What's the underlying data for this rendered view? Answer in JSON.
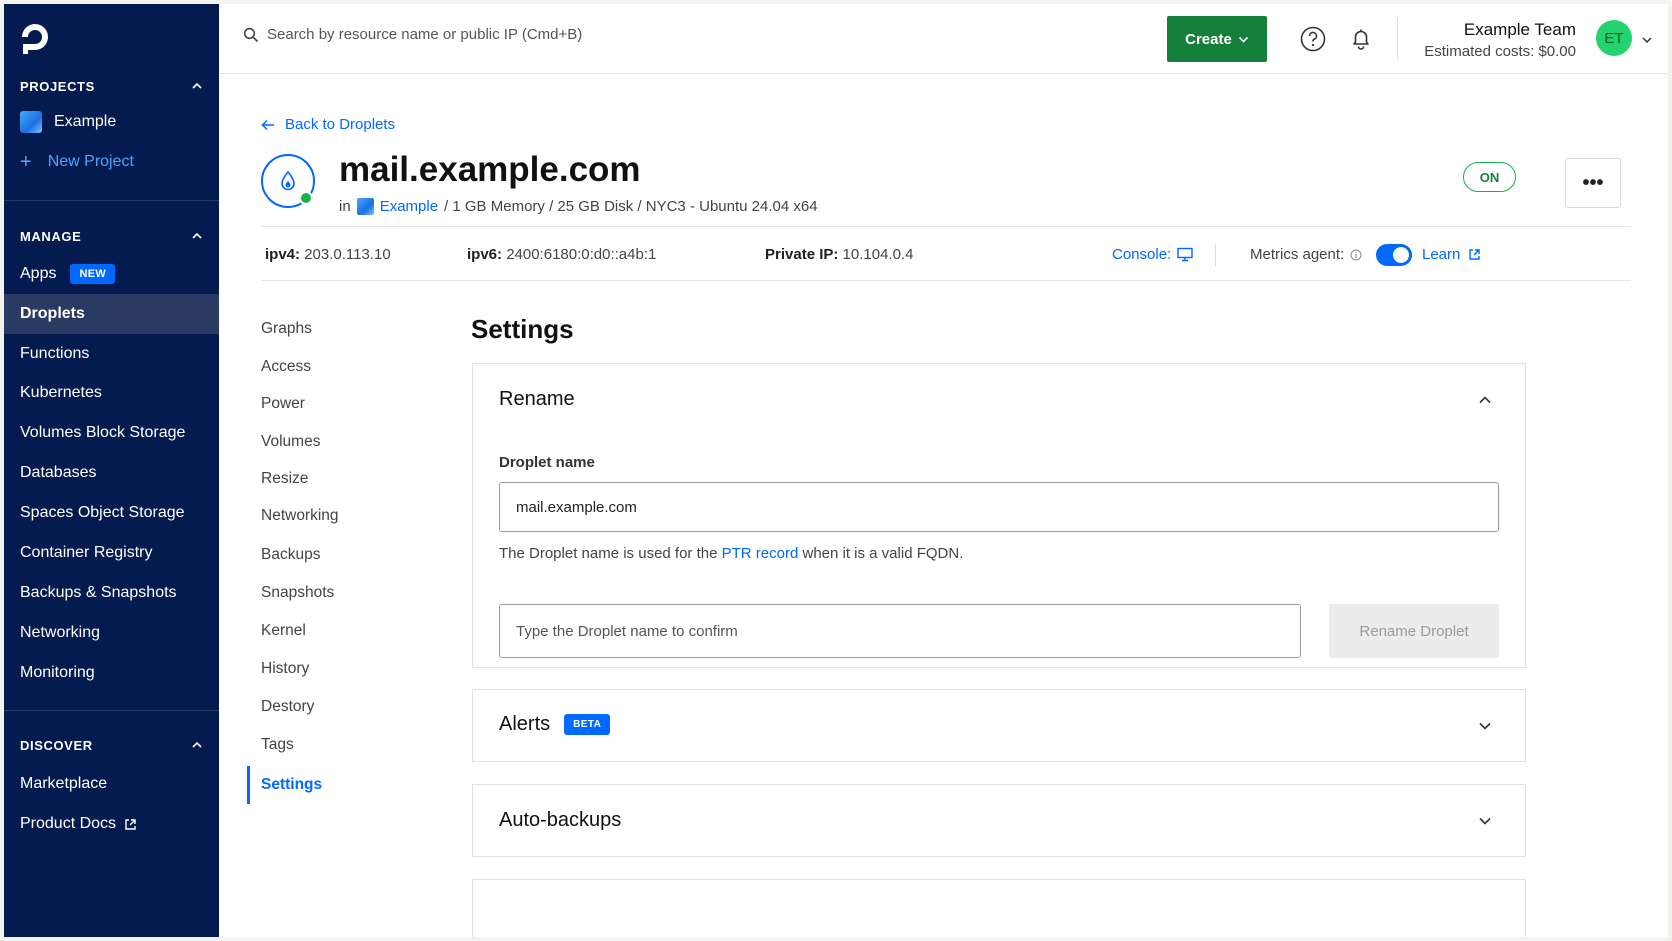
{
  "sidebar": {
    "projects_heading": "PROJECTS",
    "projects": [
      {
        "label": "Example"
      },
      {
        "label": "New Project"
      }
    ],
    "manage_heading": "MANAGE",
    "manage_items": [
      {
        "label": "Apps",
        "badge": "NEW"
      },
      {
        "label": "Droplets",
        "active": true
      },
      {
        "label": "Functions"
      },
      {
        "label": "Kubernetes"
      },
      {
        "label": "Volumes Block Storage"
      },
      {
        "label": "Databases"
      },
      {
        "label": "Spaces Object Storage"
      },
      {
        "label": "Container Registry"
      },
      {
        "label": "Backups & Snapshots"
      },
      {
        "label": "Networking"
      },
      {
        "label": "Monitoring"
      }
    ],
    "discover_heading": "DISCOVER",
    "discover_items": [
      {
        "label": "Marketplace"
      },
      {
        "label": "Product Docs"
      }
    ]
  },
  "topbar": {
    "search_placeholder": "Search by resource name or public IP (Cmd+B)",
    "create_label": "Create",
    "team_name": "Example Team",
    "estimated_costs": "Estimated costs: $0.00",
    "avatar_initials": "ET"
  },
  "droplet": {
    "back_label": "Back to Droplets",
    "name": "mail.example.com",
    "in_label": "in",
    "project_link": "Example",
    "specs": "/ 1 GB Memory / 25 GB Disk / NYC3 - Ubuntu 24.04 x64",
    "status": "ON",
    "more_label": "•••",
    "ipv4_label": "ipv4:",
    "ipv4": "203.0.113.10",
    "ipv6_label": "ipv6:",
    "ipv6": "2400:6180:0:d0::a4b:1",
    "private_ip_label": "Private IP:",
    "private_ip": "10.104.0.4",
    "console_label": "Console:",
    "metrics_label": "Metrics agent:",
    "learn_label": "Learn"
  },
  "subnav": [
    "Graphs",
    "Access",
    "Power",
    "Volumes",
    "Resize",
    "Networking",
    "Backups",
    "Snapshots",
    "Kernel",
    "History",
    "Destory",
    "Tags",
    "Settings"
  ],
  "settings": {
    "heading": "Settings",
    "rename": {
      "title": "Rename",
      "field_label": "Droplet name",
      "value": "mail.example.com",
      "help_before": "The Droplet name is used for the ",
      "help_link": "PTR record",
      "help_after": " when it is a valid FQDN.",
      "confirm_placeholder": "Type the Droplet name to confirm",
      "button": "Rename Droplet"
    },
    "alerts": {
      "title": "Alerts",
      "badge": "BETA"
    },
    "autobackups": {
      "title": "Auto-backups"
    }
  },
  "colors": {
    "sidebar_bg": "#031b4e",
    "accent": "#0069ff",
    "create_green": "#157f3b",
    "status_green": "#15b24a"
  }
}
